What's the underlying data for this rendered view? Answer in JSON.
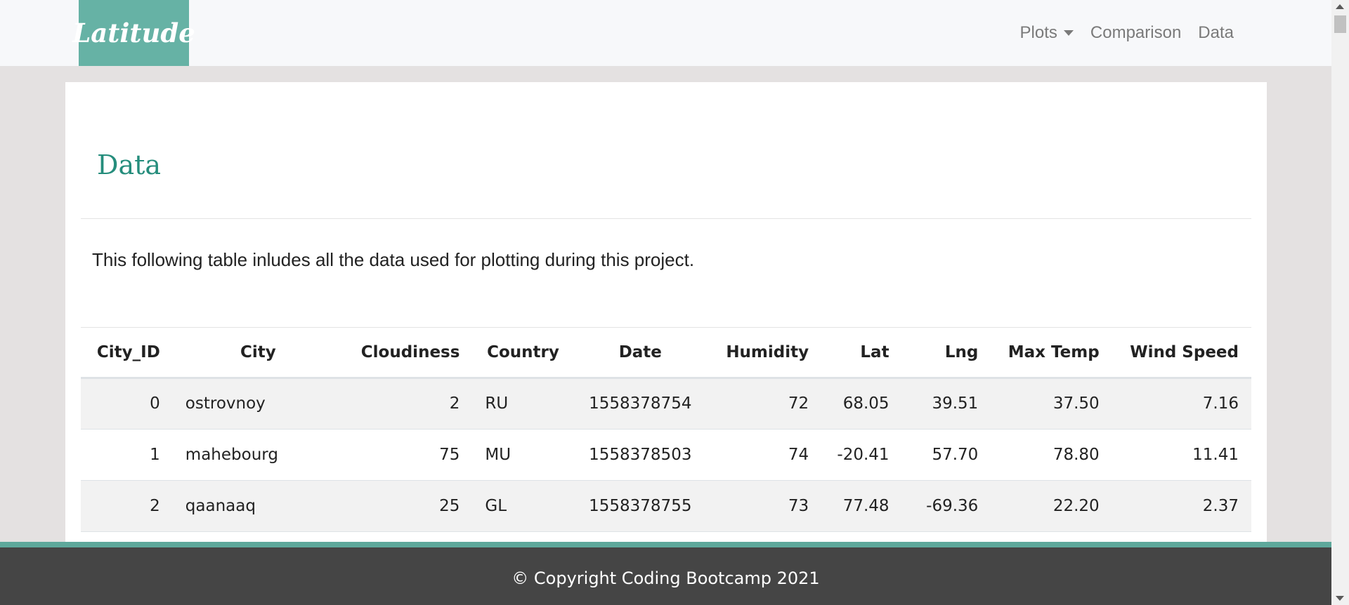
{
  "nav": {
    "brand": "Latitude",
    "items": [
      {
        "label": "Plots",
        "dropdown": true
      },
      {
        "label": "Comparison",
        "dropdown": false
      },
      {
        "label": "Data",
        "dropdown": false
      }
    ]
  },
  "main": {
    "title": "Data",
    "intro": "This following table inludes all the data used for plotting during this project.",
    "table": {
      "headers": [
        "City_ID",
        "City",
        "Cloudiness",
        "Country",
        "Date",
        "Humidity",
        "Lat",
        "Lng",
        "Max Temp",
        "Wind Speed"
      ],
      "rows": [
        [
          "0",
          "ostrovnoy",
          "2",
          "RU",
          "1558378754",
          "72",
          "68.05",
          "39.51",
          "37.50",
          "7.16"
        ],
        [
          "1",
          "mahebourg",
          "75",
          "MU",
          "1558378503",
          "74",
          "-20.41",
          "57.70",
          "78.80",
          "11.41"
        ],
        [
          "2",
          "qaanaaq",
          "25",
          "GL",
          "1558378755",
          "73",
          "77.48",
          "-69.36",
          "22.20",
          "2.37"
        ]
      ]
    }
  },
  "footer": {
    "text": "© Copyright Coding Bootcamp 2021"
  },
  "colors": {
    "accent": "#66b2a5",
    "title": "#258d7c",
    "footer_bg": "#454545",
    "page_bg": "#e4e1e1"
  }
}
